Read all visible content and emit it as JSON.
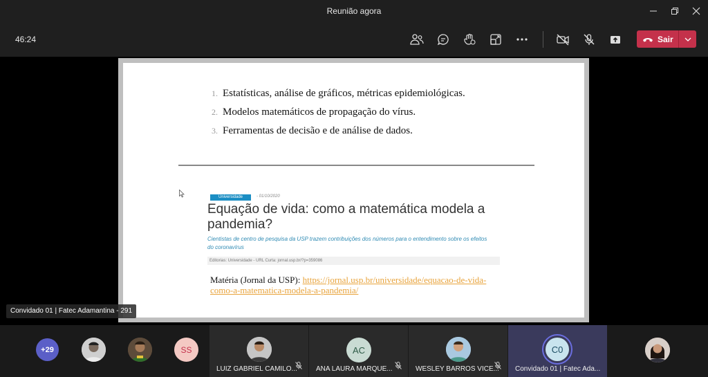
{
  "window": {
    "title": "Reunião agora"
  },
  "toolbar": {
    "timer": "46:24",
    "leave_label": "Sair"
  },
  "icons": {
    "participants": "people-icon",
    "chat": "chat-icon",
    "reactions": "reaction-icon",
    "rooms": "breakout-rooms-icon",
    "more": "more-icon",
    "camera": "camera-off-icon",
    "mic": "mic-off-icon",
    "share": "share-icon",
    "hangup": "phone-hangup-icon"
  },
  "colors": {
    "leave": "#c4314b",
    "accent_ring": "#6b6ee0",
    "link": "#e8a33b",
    "tag": "#1b8ec4"
  },
  "slide": {
    "list": [
      {
        "num": "1.",
        "text": "Estatísticas, análise de gráficos, métricas epidemiológicas."
      },
      {
        "num": "2.",
        "text": "Modelos matemáticos de propagação do vírus."
      },
      {
        "num": "3.",
        "text": "Ferramentas de decisão e de análise de dados."
      }
    ],
    "article": {
      "tag": "Universidade",
      "date": "- 01/10/2020",
      "headline": "Equação de vida: como a matemática modela a pandemia?",
      "subtitle": "Cientistas de centro de pesquisa da USP trazem contribuições dos números para o entendimento sobre os efeitos do coronavírus",
      "meta": "Editorias: Universidade - URL Curta: jornal.usp.br/?p=359086"
    },
    "materia_label": "Matéria (Jornal da USP): ",
    "materia_link": "https://jornal.usp.br/universidade/equacao-de-vida-como-a-matematica-modela-a-pandemia/"
  },
  "presenter_label": "Convidado 01 | Fatec Adamantina - 291",
  "participants": {
    "overflow": "+29",
    "initials_ss": "SS",
    "tiles": [
      {
        "name": "LUIZ GABRIEL CAMILO..."
      },
      {
        "name": "ANA LAURA MARQUE...",
        "initials": "AC"
      },
      {
        "name": "WESLEY BARROS VICE..."
      },
      {
        "name": "Convidado 01 | Fatec Ada...",
        "initials": "C0"
      }
    ]
  }
}
